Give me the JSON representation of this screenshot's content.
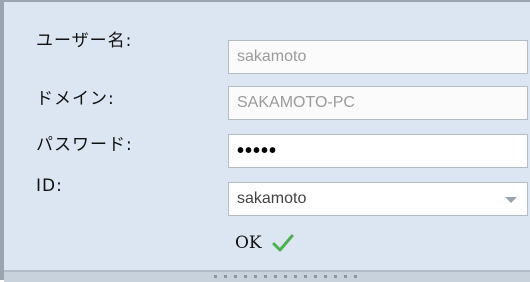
{
  "form": {
    "username": {
      "label": "ユーザー名:",
      "value": "sakamoto"
    },
    "domain": {
      "label": "ドメイン:",
      "value": "SAKAMOTO-PC"
    },
    "password": {
      "label": "パスワード:",
      "value": "•••••"
    },
    "id": {
      "label": "ID:",
      "value": "sakamoto"
    }
  },
  "status": {
    "text": "OK",
    "icon": "check-icon",
    "icon_color": "#4caf50"
  },
  "colors": {
    "panel_bg": "#dce6f2",
    "field_border": "#b4bcc6"
  }
}
